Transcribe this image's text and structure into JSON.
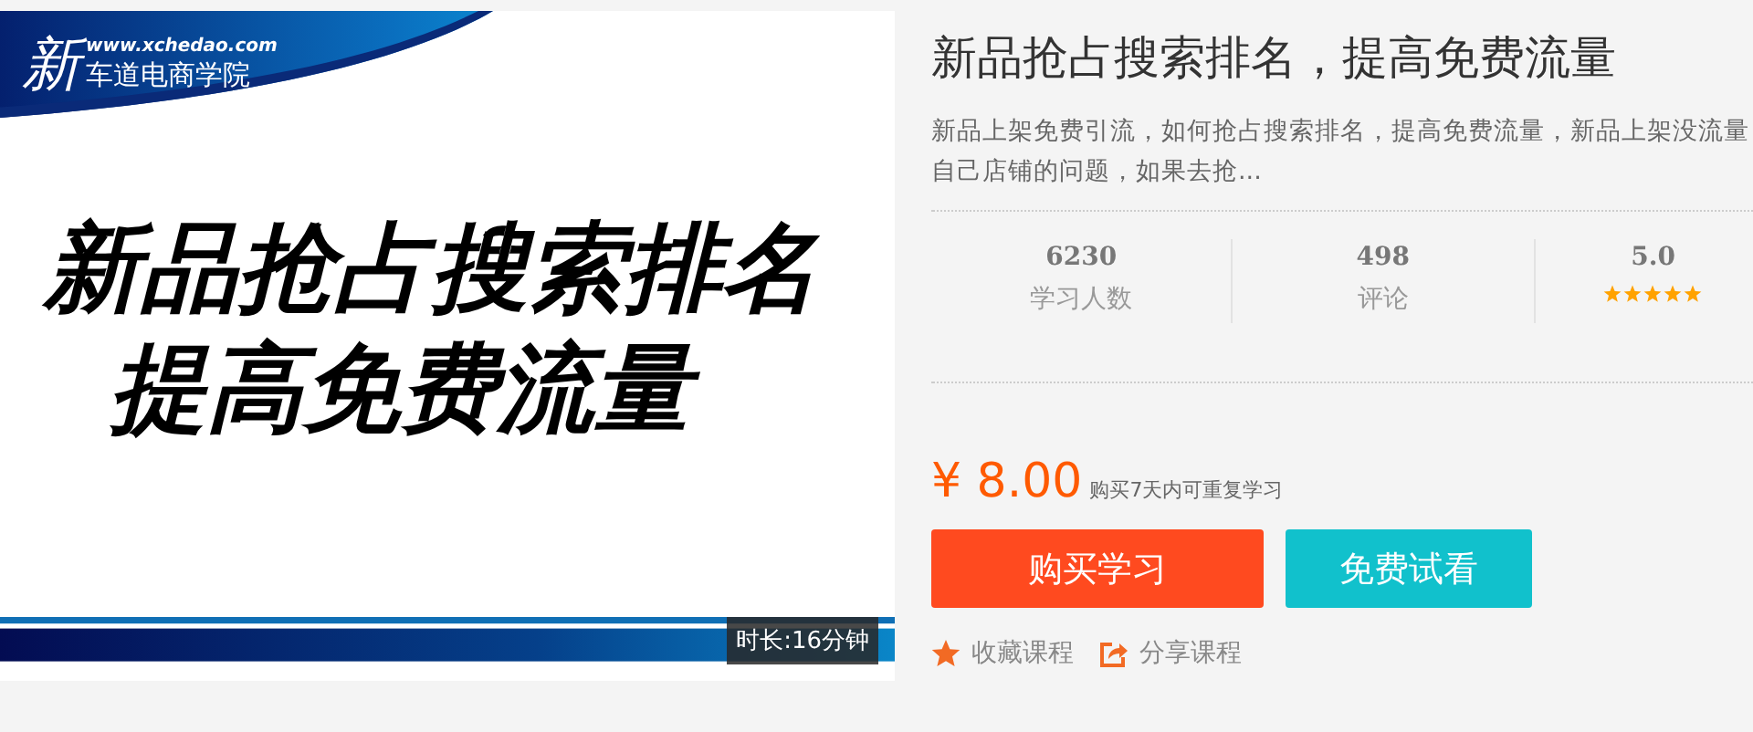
{
  "cover": {
    "logo_mark": "新",
    "logo_url": "www.xchedao.com",
    "logo_name": "车道电商学院",
    "headline": [
      "新品抢占搜索排名",
      "提高免费流量"
    ],
    "duration": "时长:16分钟"
  },
  "course": {
    "title": "新品抢占搜索排名，提高免费流量",
    "description": [
      "新品上架免费引流，如何抢占搜索排名，提高免费流量，新品上架没流量",
      "自己店铺的问题，如果去抢..."
    ],
    "stats": [
      {
        "kind": "count",
        "value": "6230",
        "label": "学习人数"
      },
      {
        "kind": "count",
        "value": "498",
        "label": "评论"
      },
      {
        "kind": "rating",
        "value": "5.0",
        "stars": 5
      }
    ],
    "price": "¥ 8.00",
    "price_note": "购买7天内可重复学习",
    "buttons": [
      {
        "kind": "buy",
        "label": "购买学习"
      },
      {
        "kind": "trial",
        "label": "免费试看"
      }
    ],
    "links": [
      {
        "kind": "favorite",
        "label": "收藏课程"
      },
      {
        "kind": "share",
        "label": "分享课程"
      }
    ]
  }
}
